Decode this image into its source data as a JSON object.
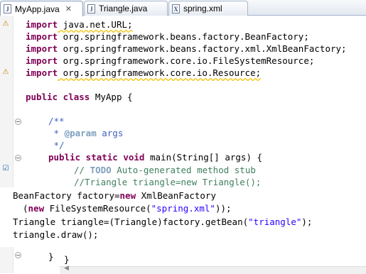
{
  "tabs": [
    {
      "label": "MyApp.java",
      "icon": "java-file-icon",
      "active": true
    },
    {
      "label": "Triangle.java",
      "icon": "java-file-icon",
      "active": false
    },
    {
      "label": "spring.xml",
      "icon": "xml-file-icon",
      "active": false
    }
  ],
  "code": {
    "imports": [
      {
        "kw": "import",
        "rest": " java.net.URL;"
      },
      {
        "kw": "import",
        "rest": " org.springframework.beans.factory.BeanFactory;"
      },
      {
        "kw": "import",
        "rest": " org.springframework.beans.factory.xml.XmlBeanFactory;"
      },
      {
        "kw": "import",
        "rest": " org.springframework.core.io.FileSystemResource;"
      },
      {
        "kw": "import",
        "rest": " org.springframework.core.io.Resource;"
      }
    ],
    "class_kw": "public class",
    "class_rest": " MyApp {",
    "jd_open": "/**",
    "jd_star": " * ",
    "jd_tag": "@param",
    "jd_param": " args",
    "jd_close": " */",
    "method_kw": "public static void",
    "method_rest": " main(String[] args) {",
    "comment_prefix": "// ",
    "comment_todo": "TODO",
    "comment_rest": " Auto-generated method stub",
    "comment2": "//Triangle triangle=new Triangle();",
    "close1": "}",
    "close2": "}"
  },
  "overlay": {
    "line1_a": "BeanFactory factory=",
    "line1_kw": "new",
    "line1_b": " XmlBeanFactory",
    "line2_a": "(",
    "line2_kw": "new",
    "line2_b": " FileSystemResource(",
    "line2_str": "\"spring.xml\"",
    "line2_c": "));",
    "line3_a": "Triangle triangle=(Triangle)factory.getBean(",
    "line3_str": "\"triangle\"",
    "line3_c": ");",
    "line4": "triangle.draw();"
  }
}
